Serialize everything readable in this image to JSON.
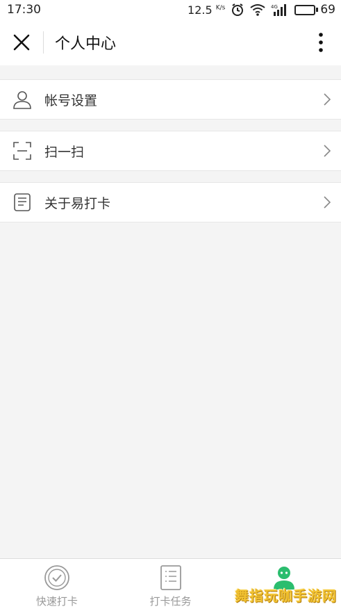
{
  "status_bar": {
    "time": "17:30",
    "speed": "12.5",
    "speed_unit": "K/s",
    "network": "4G",
    "battery": "69",
    "battery_level": 0.69
  },
  "header": {
    "title": "个人中心",
    "close_icon": "close-icon",
    "more_icon": "more-vertical-icon"
  },
  "menu": {
    "items": [
      {
        "label": "帐号设置",
        "icon": "user-icon"
      },
      {
        "label": "扫一扫",
        "icon": "scan-icon"
      },
      {
        "label": "关于易打卡",
        "icon": "document-icon"
      }
    ]
  },
  "tabs": [
    {
      "label": "快速打卡",
      "icon": "check-circle-icon",
      "active": false
    },
    {
      "label": "打卡任务",
      "icon": "task-list-icon",
      "active": false
    },
    {
      "label": "",
      "icon": "person-icon",
      "active": true
    }
  ],
  "watermark": "舞指玩咖手游网",
  "colors": {
    "accent": "#2bbd6e",
    "background": "#f4f4f4",
    "inactive": "#999999"
  }
}
